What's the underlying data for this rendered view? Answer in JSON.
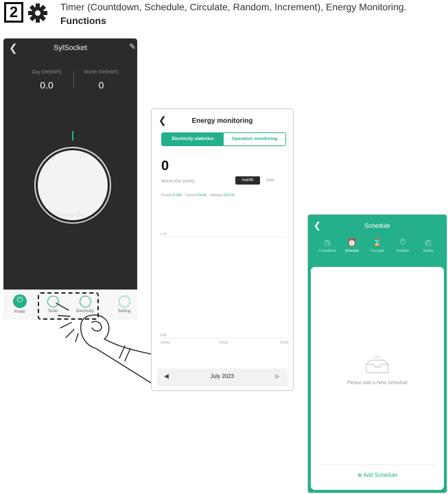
{
  "header": {
    "step_number": "2",
    "line1": "Timer (Countdown, Schedule, Circulate, Random, Increment), Energy Monitoring.",
    "line2": "Functions"
  },
  "screen_device": {
    "back_icon": "chevron-left-icon",
    "title": "SylSocket",
    "edit_icon": "pencil-icon",
    "day_label": "Day Ele(kWh)",
    "day_value": "0.0",
    "month_label": "Month Ele(kWh)",
    "month_value": "0",
    "power_status": "Power On",
    "accent_color": "#24b08a",
    "tabs": [
      {
        "label": "Power",
        "icon": "power-icon"
      },
      {
        "label": "Timer",
        "icon": "clock-icon"
      },
      {
        "label": "Electricity",
        "icon": "trend-icon"
      },
      {
        "label": "Setting",
        "icon": "gear-icon"
      }
    ]
  },
  "screen_energy": {
    "title": "Energy monitoring",
    "tab_stats": "Electricity statistics",
    "tab_operation": "Operation monitoring",
    "big_value": "0",
    "month_label": "Month Ele (kWh)",
    "month_button": "month",
    "year_button": "year",
    "power_label": "Power:",
    "power_value": "0.0W",
    "current_label": "Current:",
    "current_value": "0mA",
    "voltage_label": "Voltage:",
    "voltage_value": "220.0V",
    "date_label": "July 2023",
    "chart_data": {
      "type": "line",
      "x": [
        "07/01",
        "07/16",
        "07/31"
      ],
      "ytick_labels": [
        "0.00",
        "1.00"
      ],
      "ylim": [
        0,
        1
      ],
      "series": [
        {
          "values": [
            0,
            0,
            0
          ]
        }
      ]
    }
  },
  "screen_schedule": {
    "title": "Schedule",
    "nav": [
      {
        "label": "Countdown",
        "icon": "clock-icon",
        "active": false
      },
      {
        "label": "Schedule",
        "icon": "alarm-icon",
        "active": true
      },
      {
        "label": "Circulate",
        "icon": "hourglass-icon",
        "active": false
      },
      {
        "label": "Random",
        "icon": "stopwatch-icon",
        "active": false
      },
      {
        "label": "Setting",
        "icon": "gauge-icon",
        "active": false
      }
    ],
    "empty_text": "Please Add a New Schedule",
    "add_label": "Add Schedule"
  }
}
